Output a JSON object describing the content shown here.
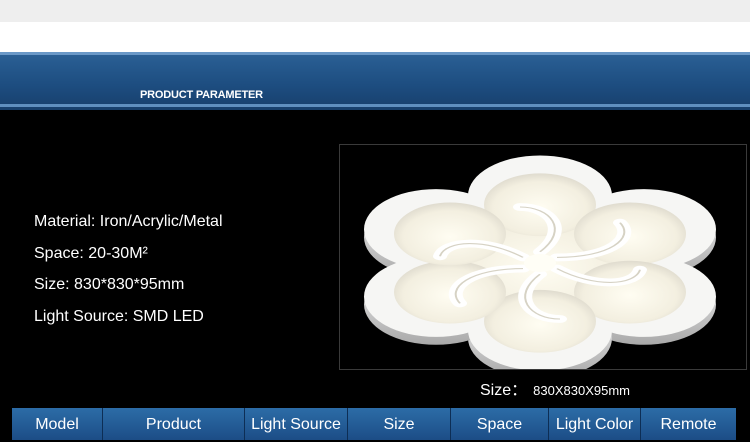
{
  "header": {
    "title": "PRODUCT PARAMETER"
  },
  "specs": [
    {
      "label": "Material: ",
      "value": "Iron/Acrylic/Metal"
    },
    {
      "label": "Space: ",
      "value": "20-30M²"
    },
    {
      "label": "Size: ",
      "value": "830*830*95mm"
    },
    {
      "label": "Light Source: ",
      "value": "SMD LED"
    }
  ],
  "photo": {
    "icon": "flower-ceiling-lamp-image"
  },
  "size_caption": {
    "label": "Size：",
    "value": "830X830X95mm"
  },
  "table": {
    "headers": [
      "Model",
      "Product",
      "Light Source",
      "Size",
      "Space",
      "Light Color",
      "Remote"
    ]
  },
  "colors": {
    "banner": "#1d4d80",
    "table_header": "#2c6ca7",
    "background": "#000000"
  }
}
